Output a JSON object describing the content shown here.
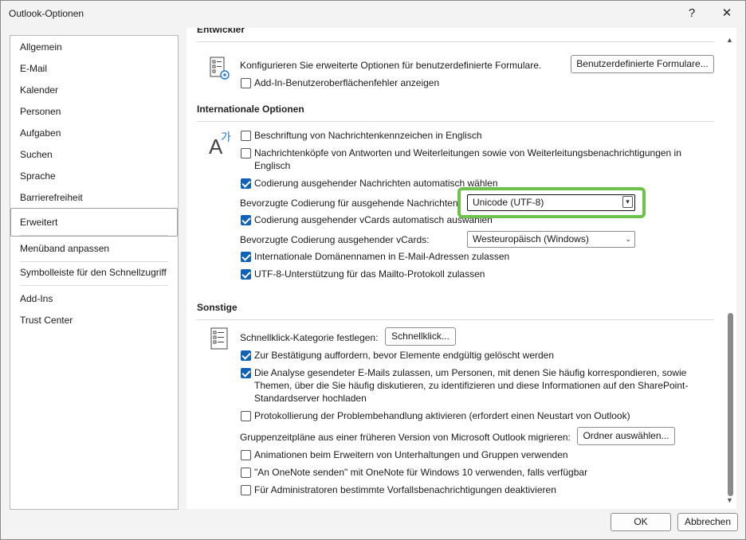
{
  "window": {
    "title": "Outlook-Optionen",
    "help_label": "?",
    "close_label": "✕"
  },
  "sidebar": {
    "items": [
      {
        "label": "Allgemein"
      },
      {
        "label": "E-Mail"
      },
      {
        "label": "Kalender"
      },
      {
        "label": "Personen"
      },
      {
        "label": "Aufgaben"
      },
      {
        "label": "Suchen"
      },
      {
        "label": "Sprache"
      },
      {
        "label": "Barrierefreiheit"
      },
      {
        "label": "Erweitert",
        "selected": true
      },
      {
        "label": "Menüband anpassen"
      },
      {
        "label": "Symbolleiste für den Schnellzugriff"
      },
      {
        "label": "Add-Ins"
      },
      {
        "label": "Trust Center"
      }
    ]
  },
  "developer": {
    "heading": "Entwickler",
    "forms_text": "Konfigurieren Sie erweiterte Optionen für benutzerdefinierte Formulare.",
    "forms_button": "Benutzerdefinierte Formulare...",
    "addin_errors": {
      "label": "Add-In-Benutzeroberflächenfehler anzeigen",
      "checked": false
    }
  },
  "international": {
    "heading": "Internationale Optionen",
    "flags_english": {
      "label": "Beschriftung von Nachrichtenkennzeichen in Englisch",
      "checked": false
    },
    "headers_english": {
      "label": "Nachrichtenköpfe von Antworten und Weiterleitungen sowie von Weiterleitungsbenachrichtigungen in",
      "label2": "Englisch",
      "checked": false
    },
    "auto_encoding": {
      "label": "Codierung ausgehender Nachrichten automatisch wählen",
      "checked": true
    },
    "preferred_encoding_label": "Bevorzugte Codierung für ausgehende Nachrichten:",
    "preferred_encoding_value": "Unicode (UTF-8)",
    "auto_vcard": {
      "label": "Codierung ausgehender vCards automatisch auswählen",
      "checked": true
    },
    "vcard_encoding_label": "Bevorzugte Codierung ausgehender vCards:",
    "vcard_encoding_value": "Westeuropäisch (Windows)",
    "idn": {
      "label": "Internationale Domänennamen in E-Mail-Adressen zulassen",
      "checked": true
    },
    "utf8_mailto": {
      "label": "UTF-8-Unterstützung für das Mailto-Protokoll zulassen",
      "checked": true
    }
  },
  "other": {
    "heading": "Sonstige",
    "quickclick_label": "Schnellklick-Kategorie festlegen:",
    "quickclick_button": "Schnellklick...",
    "confirm_delete": {
      "label": "Zur Bestätigung auffordern, bevor Elemente endgültig gelöscht werden",
      "checked": true
    },
    "analysis": {
      "label": "Die Analyse gesendeter E-Mails zulassen, um Personen, mit denen Sie häufig korrespondieren, sowie",
      "label2": "Themen, über die Sie häufig diskutieren, zu identifizieren und diese Informationen auf den SharePoint-",
      "label3": "Standardserver hochladen",
      "checked": true
    },
    "troubleshoot_log": {
      "label": "Protokollierung der Problembehandlung aktivieren (erfordert einen Neustart von Outlook)",
      "checked": false
    },
    "migrate_label": "Gruppenzeitpläne aus einer früheren Version von Microsoft Outlook migrieren:",
    "migrate_button": "Ordner auswählen...",
    "animations": {
      "label": "Animationen beim Erweitern von Unterhaltungen und Gruppen verwenden",
      "checked": false
    },
    "onenote": {
      "label": "\"An OneNote senden\" mit OneNote für Windows 10 verwenden, falls verfügbar",
      "checked": false
    },
    "admin_notifications": {
      "label": "Für Administratoren bestimmte Vorfallsbenachrichtigungen deaktivieren",
      "checked": false
    }
  },
  "footer": {
    "ok": "OK",
    "cancel": "Abbrechen"
  },
  "colors": {
    "accent": "#0f62b6",
    "highlight": "#6cc24a"
  }
}
